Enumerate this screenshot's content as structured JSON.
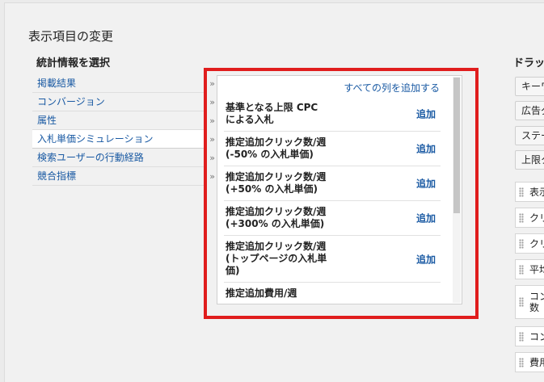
{
  "dialog": {
    "title": "表示項目の変更"
  },
  "left": {
    "heading": "統計情報を選択",
    "arrow_glyph": "»",
    "categories": [
      {
        "label": "掲載結果"
      },
      {
        "label": "コンバージョン"
      },
      {
        "label": "属性"
      },
      {
        "label": "入札単価シミュレーション",
        "selected": true
      },
      {
        "label": "検索ユーザーの行動経路"
      },
      {
        "label": "競合指標"
      }
    ]
  },
  "panel": {
    "add_all": "すべての列を追加する",
    "metrics": [
      {
        "label": "基準となる上限 CPC\nによる入札",
        "add": "追加"
      },
      {
        "label": "推定追加クリック数/週\n(-50% の入札単価)",
        "add": "追加"
      },
      {
        "label": "推定追加クリック数/週\n(+50% の入札単価)",
        "add": "追加"
      },
      {
        "label": "推定追加クリック数/週\n(+300% の入札単価)",
        "add": "追加"
      },
      {
        "label": "推定追加クリック数/週\n(トップページの入札単\n価)",
        "add": "追加"
      },
      {
        "label": "推定追加費用/週",
        "add": ""
      }
    ]
  },
  "right": {
    "heading": "ドラッ",
    "buttons": [
      {
        "label": "キーワ"
      },
      {
        "label": "広告グ"
      },
      {
        "label": "ステー"
      },
      {
        "label": "上限ク"
      }
    ],
    "columns": [
      {
        "label": "表示"
      },
      {
        "label": "クリ"
      },
      {
        "label": "クリ"
      },
      {
        "label": "平均"
      },
      {
        "label": "コン\n数"
      },
      {
        "label": "コン"
      },
      {
        "label": "費用"
      }
    ]
  },
  "colors": {
    "link": "#1a5aa3",
    "highlight": "#e01d1d",
    "background": "#f1f1f1"
  }
}
